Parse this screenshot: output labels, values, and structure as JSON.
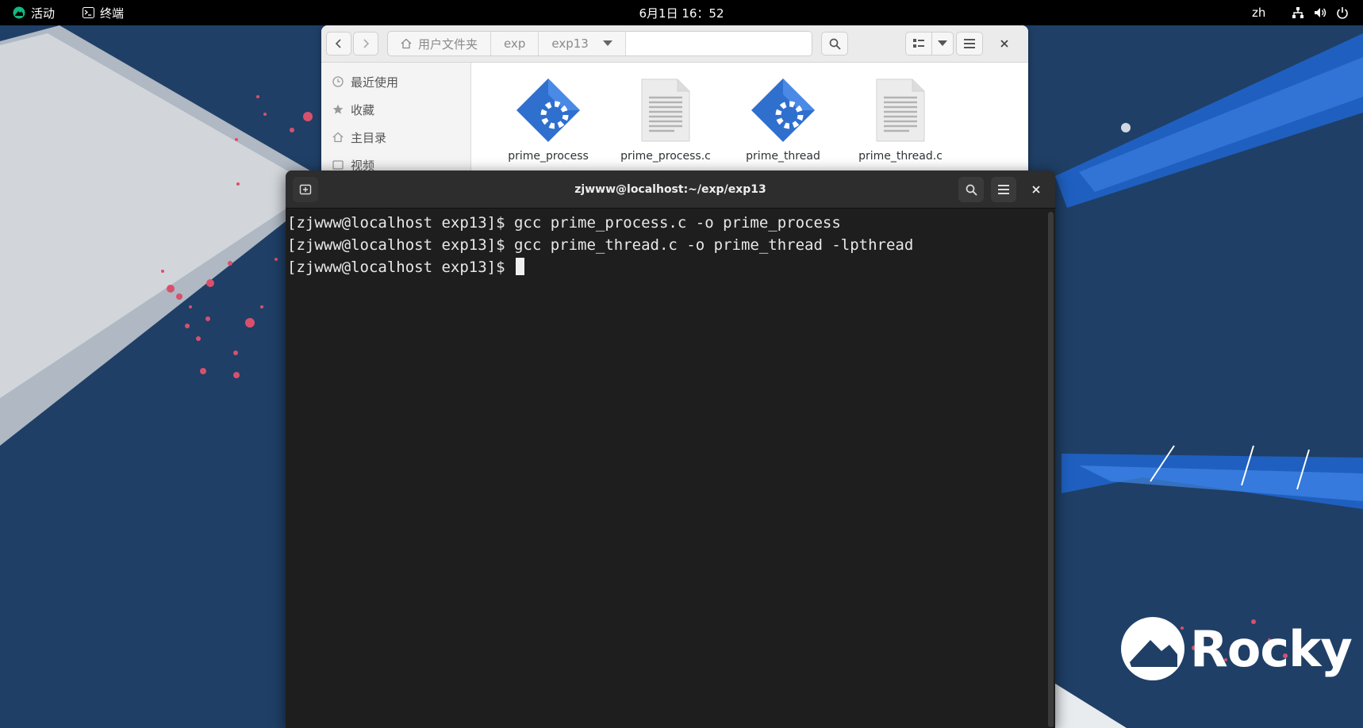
{
  "topbar": {
    "activities_label": "活动",
    "app_label": "终端",
    "clock": "6月1日  16：52",
    "lang": "zh",
    "tray_icons": [
      "network-icon",
      "volume-icon",
      "power-icon"
    ]
  },
  "file_manager": {
    "breadcrumbs": [
      "用户文件夹",
      "exp",
      "exp13"
    ],
    "sidebar": [
      {
        "label": "最近使用",
        "icon": "clock-icon"
      },
      {
        "label": "收藏",
        "icon": "star-icon"
      },
      {
        "label": "主目录",
        "icon": "home-icon"
      },
      {
        "label": "视频",
        "icon": "video-icon"
      }
    ],
    "files": [
      {
        "name": "prime_process",
        "type": "executable"
      },
      {
        "name": "prime_process.c",
        "type": "text"
      },
      {
        "name": "prime_thread",
        "type": "executable"
      },
      {
        "name": "prime_thread.c",
        "type": "text"
      }
    ]
  },
  "terminal": {
    "title": "zjwww@localhost:~/exp/exp13",
    "lines": [
      "[zjwww@localhost exp13]$ gcc prime_process.c -o prime_process",
      "[zjwww@localhost exp13]$ gcc prime_thread.c -o prime_thread -lpthread",
      "[zjwww@localhost exp13]$ "
    ]
  },
  "wallpaper": {
    "logo_text": "Rocky",
    "colors": {
      "background": "#1f3f66",
      "stripe": "#c9ced3",
      "accent_blue": "#1f5fbf",
      "dots": "#d9506d"
    }
  }
}
